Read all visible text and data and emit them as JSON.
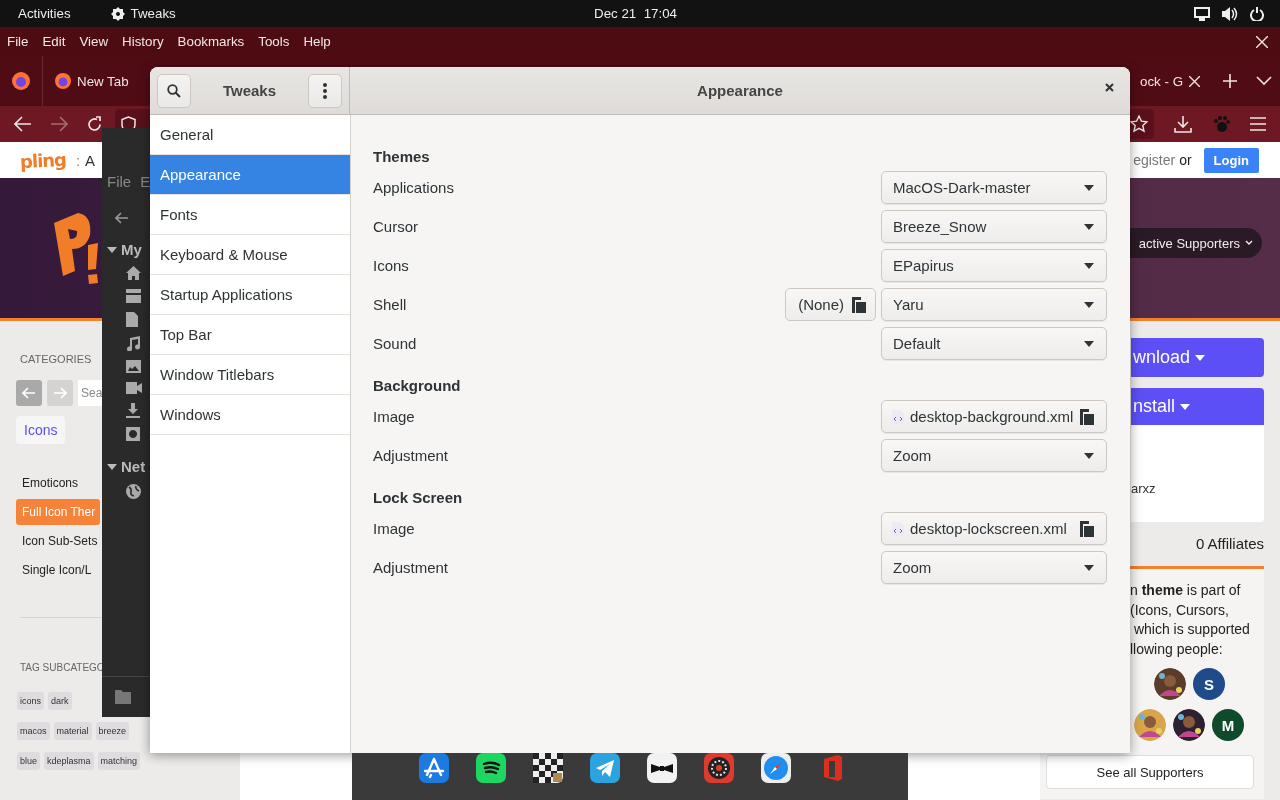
{
  "top_bar": {
    "activities": "Activities",
    "app_name": "Tweaks",
    "date": "Dec 21",
    "time": "17:04"
  },
  "browser": {
    "menu": [
      "File",
      "Edit",
      "View",
      "History",
      "Bookmarks",
      "Tools",
      "Help"
    ],
    "tabs": [
      "New Tab",
      "ock - G"
    ],
    "page": {
      "logo": "pling",
      "crumb_separator": ":",
      "crumb": "A",
      "register": "egister",
      "or": "or",
      "login": "Login",
      "supporters_pill": "active Supporters",
      "categories_heading": "CATEGORIES",
      "search_placeholder": "Sea",
      "chip": "Icons",
      "categories": [
        {
          "label": "Emoticons",
          "selected": false
        },
        {
          "label": "Full Icon Ther",
          "selected": true
        },
        {
          "label": "Icon Sub-Sets",
          "selected": false
        },
        {
          "label": "Single Icon/L",
          "selected": false
        }
      ],
      "tag_heading": "TAG SUBCATEGO",
      "tag_rows": [
        [
          "icons",
          "dark"
        ],
        [
          "macos",
          "material",
          "breeze"
        ],
        [
          "blue",
          "kdeplasma",
          "matching"
        ]
      ],
      "download": "wnload",
      "install": "nstall",
      "card_text": "arxz",
      "affiliates": "0 Affiliates",
      "supporters_text": "n **theme** is part of\n(Icons, Cursors,\n which is supported\nllowing people:",
      "avatar_rows": [
        [
          {
            "kind": "picture"
          },
          {
            "kind": "letter",
            "letter": "S",
            "color": "#1f4b8a"
          }
        ],
        [
          {
            "kind": "picture"
          },
          {
            "kind": "picture"
          },
          {
            "kind": "letter",
            "letter": "M",
            "color": "#0f4a2b"
          }
        ]
      ],
      "see_all": "See all Supporters"
    }
  },
  "files": {
    "menu": [
      "File",
      "E"
    ],
    "places_heading": "My",
    "network_heading": "Net"
  },
  "tweaks": {
    "title": "Tweaks",
    "page_title": "Appearance",
    "sidebar": [
      {
        "label": "General",
        "selected": false
      },
      {
        "label": "Appearance",
        "selected": true
      },
      {
        "label": "Fonts",
        "selected": false
      },
      {
        "label": "Keyboard & Mouse",
        "selected": false
      },
      {
        "label": "Startup Applications",
        "selected": false
      },
      {
        "label": "Top Bar",
        "selected": false
      },
      {
        "label": "Window Titlebars",
        "selected": false
      },
      {
        "label": "Windows",
        "selected": false
      }
    ],
    "sections": [
      {
        "heading": "Themes",
        "rows": [
          {
            "label": "Applications",
            "kind": "combo",
            "value": "MacOS-Dark-master"
          },
          {
            "label": "Cursor",
            "kind": "combo",
            "value": "Breeze_Snow"
          },
          {
            "label": "Icons",
            "kind": "combo",
            "value": "EPapirus"
          },
          {
            "label": "Shell",
            "kind": "combo",
            "value": "Yaru",
            "file_button": "(None)"
          },
          {
            "label": "Sound",
            "kind": "combo",
            "value": "Default"
          }
        ]
      },
      {
        "heading": "Background",
        "rows": [
          {
            "label": "Image",
            "kind": "file",
            "value": "desktop-background.xml"
          },
          {
            "label": "Adjustment",
            "kind": "combo",
            "value": "Zoom"
          }
        ]
      },
      {
        "heading": "Lock Screen",
        "rows": [
          {
            "label": "Image",
            "kind": "file",
            "value": "desktop-lockscreen.xml"
          },
          {
            "label": "Adjustment",
            "kind": "combo",
            "value": "Zoom"
          }
        ]
      }
    ]
  },
  "dock": {
    "apps": [
      {
        "kind": "app-store"
      },
      {
        "kind": "music"
      },
      {
        "kind": "chess"
      },
      {
        "kind": "messenger"
      },
      {
        "kind": "bowtie"
      },
      {
        "kind": "dial"
      },
      {
        "kind": "compass"
      },
      {
        "kind": "office"
      }
    ]
  }
}
